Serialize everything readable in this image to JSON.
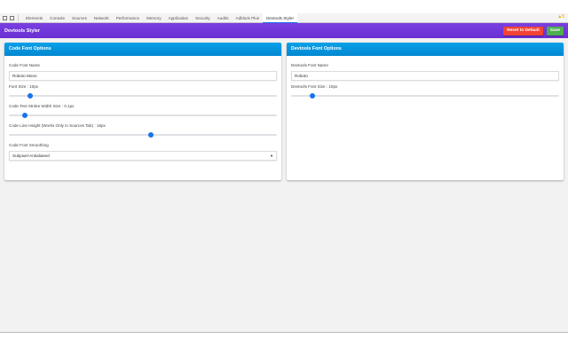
{
  "devtools_tabs": [
    "Elements",
    "Console",
    "Sources",
    "Network",
    "Performance",
    "Memory",
    "Application",
    "Security",
    "Audits",
    "Adblock Plus",
    "Devtools Styler"
  ],
  "active_tab": "Devtools Styler",
  "warning_badge": "▲5",
  "header": {
    "title": "Devtools Styler",
    "reset_label": "Reset to Default",
    "save_label": "Save",
    "reset_color": "#f44336",
    "save_color": "#4caf50"
  },
  "code_card": {
    "title": "Code Font Options",
    "font_name_label": "Code Font Name",
    "font_name_value": "Roboto Mono",
    "font_size_label": "Font Size : 10px",
    "font_size_fraction": 0.08,
    "stroke_label": "Code Text Stroke Width Size : 0.1px",
    "stroke_fraction": 0.06,
    "line_height_label": "Code Line Height (Works Only in Sources Tab) : 16px",
    "line_height_fraction": 0.53,
    "smoothing_label": "Code Font Smoothing",
    "smoothing_value": "Subpixel-Antialiased"
  },
  "devtools_card": {
    "title": "Devtools Font Options",
    "font_name_label": "Devtools Font Name",
    "font_name_value": "Roboto",
    "font_size_label": "Devtools Font Size : 10px",
    "font_size_fraction": 0.08
  }
}
